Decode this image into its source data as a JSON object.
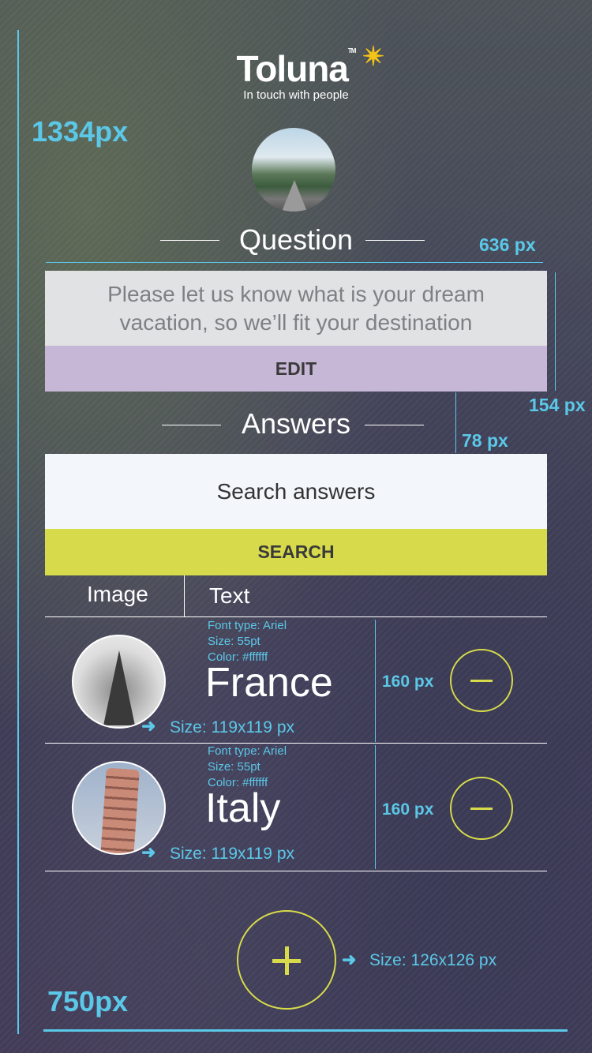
{
  "logo": {
    "word": "Toluna",
    "tm": "TM",
    "tagline": "In touch with people",
    "star": "✴"
  },
  "measurements": {
    "height_label": "1334px",
    "width_label": "750px",
    "question_width": "636 px",
    "question_height": "154 px",
    "answers_gap": "78 px",
    "row_height_1": "160 px",
    "row_height_2": "160 px"
  },
  "question": {
    "title": "Question",
    "text": "Please let us know what is your dream vacation, so we’ll fit your destination",
    "edit_label": "EDIT"
  },
  "answers": {
    "title": "Answers",
    "search_placeholder": "Search answers",
    "search_label": "SEARCH",
    "col_image": "Image",
    "col_text": "Text",
    "items": [
      {
        "country": "France",
        "font_type": "Font type: Ariel",
        "size": "Size: 55pt",
        "color": "Color: #ffffff",
        "image_size": "Size: 119x119 px"
      },
      {
        "country": "Italy",
        "font_type": "Font type: Ariel",
        "size": "Size: 55pt",
        "color": "Color: #ffffff",
        "image_size": "Size: 119x119 px"
      }
    ],
    "add_button_size": "Size: 126x126 px"
  },
  "colors": {
    "accent_blue": "#5bc8e8",
    "lime": "#d7db4b",
    "lavender": "#c7b7d6"
  },
  "icons": [
    "minus-icon",
    "plus-icon",
    "arrow-right-icon"
  ]
}
